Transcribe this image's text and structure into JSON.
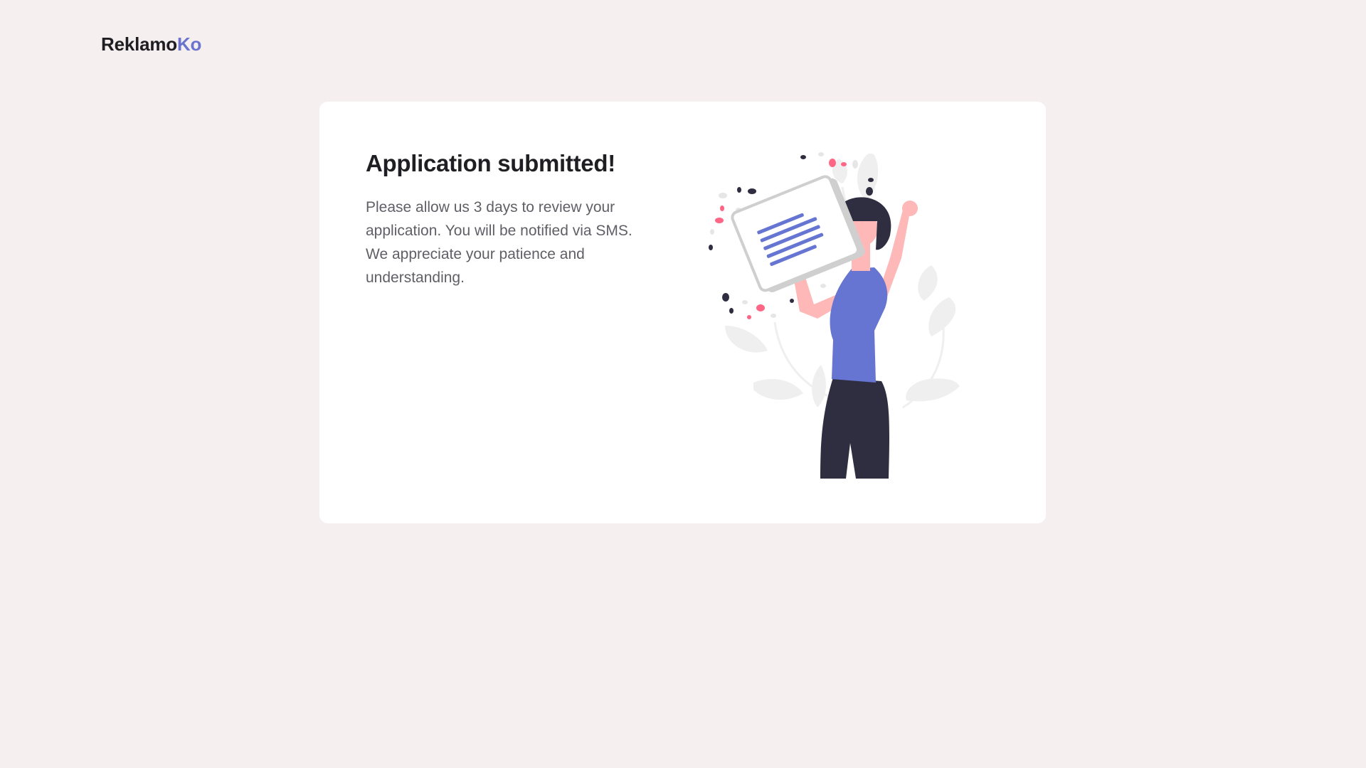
{
  "brand": {
    "name_part1": "Reklamo",
    "name_part2": "Ko",
    "accent_color": "#6a74cf"
  },
  "confirmation": {
    "title": "Application submitted!",
    "message": "Please allow us 3 days to review your application. You will be notified via SMS. We appreciate your patience and understanding."
  },
  "illustration": {
    "icon": "woman-celebrating-with-document-illustration"
  }
}
